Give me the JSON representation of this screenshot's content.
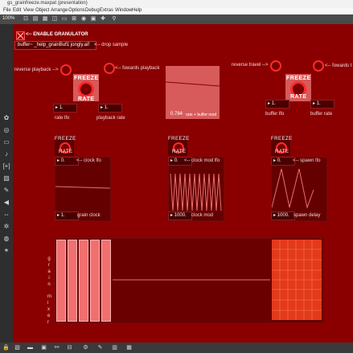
{
  "window": {
    "title": "gs_grainfreeze.maxpat (presentation)"
  },
  "menu": [
    "File",
    "Edit",
    "View",
    "Object",
    "Arrange",
    "Options",
    "Debug",
    "Extras",
    "Window",
    "Help"
  ],
  "toolbar": {
    "zoom": "100%"
  },
  "header": {
    "enable_label": "<-- ENABLE GRANULATOR",
    "buffer_message": "buffer~ _help_grainBuf1 jongly.aif",
    "drop_label": "<-- drop sample"
  },
  "playback": {
    "reverse_label": "reverse playback -->",
    "forwards_label": "<-- fowards playback",
    "freeze": "FREEZE",
    "rate": "RATE",
    "rate_lfo_value": "1.",
    "rate_lfo_label": "rate lfo",
    "playback_rate_value": "1.",
    "playback_rate_label": "playback rate",
    "mod_value": "0.784",
    "mod_label": "rate + buffer mod"
  },
  "travel": {
    "reverse_label": "reverse travel -->",
    "forwards_label": "<-- fowards t",
    "freeze": "FREEZE",
    "rate": "RATE",
    "buffer_lfo_value": "1.",
    "buffer_lfo_label": "buffer lfo",
    "buffer_rate_value": "1.",
    "buffer_rate_label": "buffer rate"
  },
  "clock": {
    "freeze": "FREEZE",
    "rate": "RATE",
    "lfo_value": "0.",
    "lfo_label": "<-- clock lfo",
    "value": "1.",
    "label": "grain clock"
  },
  "clock_mod": {
    "freeze": "FREEZE",
    "rate": "RATE",
    "lfo_value": "0.",
    "lfo_label": "<-- clock mod lfo",
    "value": "1000.",
    "label": "clock mod"
  },
  "spawn": {
    "freeze": "FREEZE",
    "rate": "RATE",
    "lfo_value": "0.",
    "lfo_label": "<-- spawn lfo",
    "value": "1000.",
    "label": "spawn delay"
  },
  "mixer": {
    "label_top": "grain",
    "label_bottom": "mixer",
    "faders": [
      1,
      1,
      1,
      1,
      1
    ]
  },
  "colors": {
    "canvas": "#8a0000",
    "accent": "#ff2a2a",
    "panel": "#d75a5a"
  }
}
